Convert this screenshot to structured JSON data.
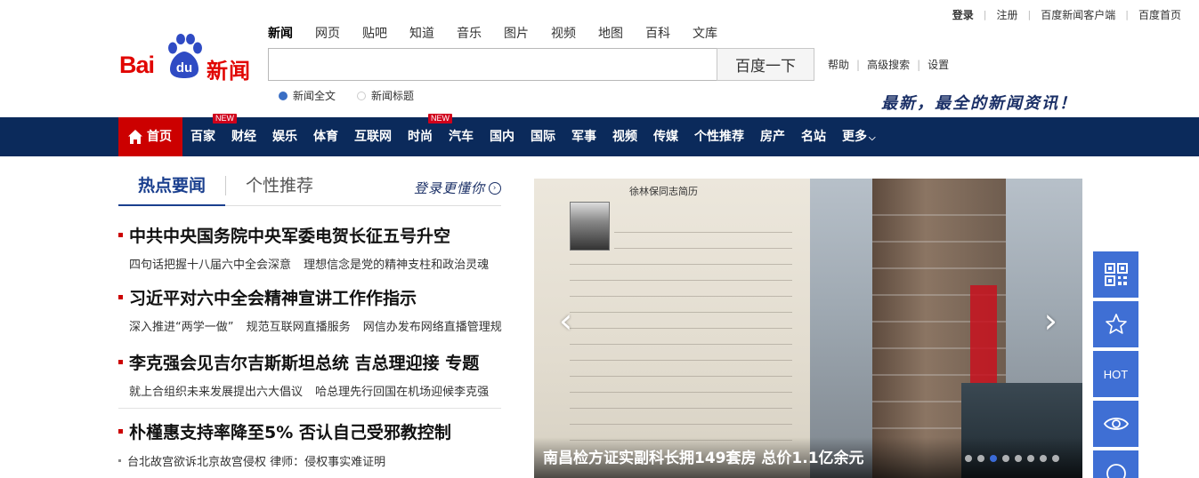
{
  "top_links": {
    "login": "登录",
    "register": "注册",
    "client": "百度新闻客户端",
    "home": "百度首页"
  },
  "logo": {
    "bai": "Bai",
    "du": "du",
    "suffix": "新闻"
  },
  "search_tabs": [
    "新闻",
    "网页",
    "贴吧",
    "知道",
    "音乐",
    "图片",
    "视频",
    "地图",
    "百科",
    "文库"
  ],
  "search": {
    "value": "",
    "button": "百度一下"
  },
  "help_links": [
    "帮助",
    "高级搜索",
    "设置"
  ],
  "radio_options": [
    {
      "label": "新闻全文",
      "checked": true
    },
    {
      "label": "新闻标题",
      "checked": false
    }
  ],
  "slogan": "最新，最全的新闻资讯！",
  "nav": {
    "home": "首页",
    "items": [
      "百家",
      "财经",
      "娱乐",
      "体育",
      "互联网",
      "时尚",
      "汽车",
      "国内",
      "国际",
      "军事",
      "视频",
      "传媒",
      "个性推荐",
      "房产",
      "名站",
      "更多"
    ],
    "new_badge": "NEW"
  },
  "tabs": {
    "hot": "热点要闻",
    "personal": "个性推荐",
    "login_more": "登录更懂你"
  },
  "headlines": [
    {
      "title": "中共中央国务院中央军委电贺长征五号升空",
      "subs": [
        "四句话把握十八届六中全会深意",
        "理想信念是党的精神支柱和政治灵魂"
      ]
    },
    {
      "title": "习近平对六中全会精神宣讲工作作指示",
      "subs": [
        "深入推进“两学一做”",
        "规范互联网直播服务",
        "网信办发布网络直播管理规"
      ]
    },
    {
      "title": "李克强会见吉尔吉斯斯坦总统  吉总理迎接  专题",
      "subs": [
        "就上合组织未来发展提出六大倡议",
        "哈总理先行回国在机场迎候李克强"
      ]
    },
    {
      "title": "朴槿惠支持率降至5% 否认自己受邪教控制",
      "subs": []
    }
  ],
  "small_item": "台北故宫欲诉北京故宫侵权 律师：侵权事实难证明",
  "carousel": {
    "doc_title": "徐林保同志简历",
    "caption": "南昌检方证实副科长拥149套房 总价1.1亿余元",
    "dot_count": 8,
    "active_dot": 2
  },
  "side": {
    "hot": "HOT"
  },
  "colors": {
    "nav_bg": "#0b2a5b",
    "brand_red": "#e10602",
    "accent_blue": "#3f6fd4"
  }
}
